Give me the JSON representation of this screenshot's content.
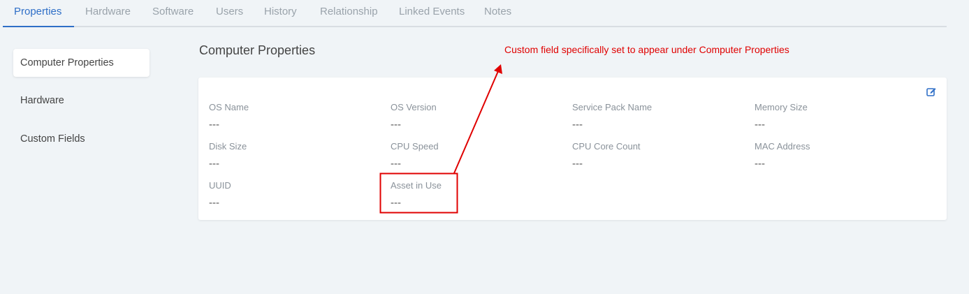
{
  "tabs": [
    {
      "label": "Properties",
      "active": true
    },
    {
      "label": "Hardware",
      "active": false
    },
    {
      "label": "Software",
      "active": false
    },
    {
      "label": "Users",
      "active": false
    },
    {
      "label": "History",
      "active": false
    },
    {
      "label": "Relationship",
      "active": false
    },
    {
      "label": "Linked Events",
      "active": false
    },
    {
      "label": "Notes",
      "active": false
    }
  ],
  "sidebar": {
    "items": [
      {
        "label": "Computer Properties",
        "active": true
      },
      {
        "label": "Hardware",
        "active": false
      },
      {
        "label": "Custom Fields",
        "active": false
      }
    ]
  },
  "section": {
    "title": "Computer Properties"
  },
  "annotation": {
    "text": "Custom field specifically set to appear under Computer Properties",
    "color": "#e00000"
  },
  "fields": [
    {
      "label": "OS Name",
      "value": "---"
    },
    {
      "label": "OS Version",
      "value": "---"
    },
    {
      "label": "Service Pack Name",
      "value": "---"
    },
    {
      "label": "Memory Size",
      "value": "---"
    },
    {
      "label": "Disk Size",
      "value": "---"
    },
    {
      "label": "CPU Speed",
      "value": "---"
    },
    {
      "label": "CPU Core Count",
      "value": "---"
    },
    {
      "label": "MAC Address",
      "value": "---"
    },
    {
      "label": "UUID",
      "value": "---"
    },
    {
      "label": "Asset in Use",
      "value": "---"
    }
  ],
  "icons": {
    "edit": "edit-icon"
  },
  "colors": {
    "accent": "#2f6fc7",
    "highlight": "#e00000",
    "background": "#f0f4f7"
  }
}
